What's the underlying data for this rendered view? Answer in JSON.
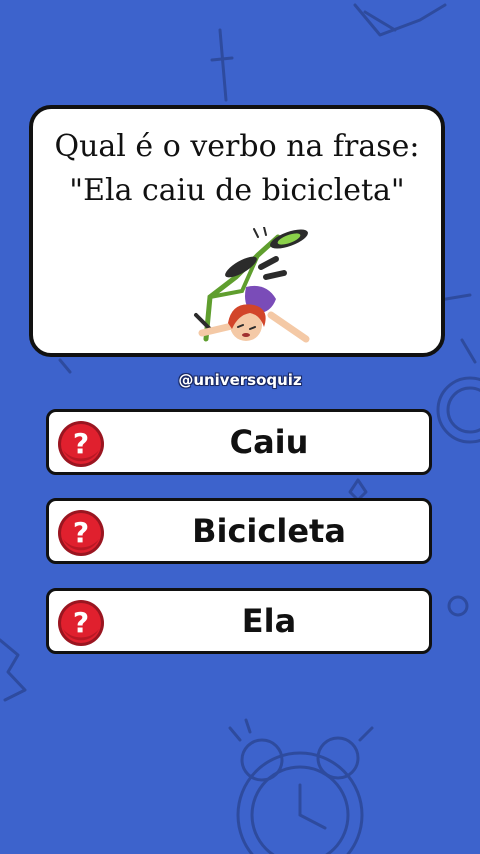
{
  "question": {
    "line1": "Qual é o verbo na frase:",
    "line2": "\"Ela caiu de bicicleta\""
  },
  "illustration": {
    "icon": "child-falling-off-bicycle-icon"
  },
  "handle": "@universoquiz",
  "options": [
    {
      "label": "Caiu",
      "icon": "question-mark-icon"
    },
    {
      "label": "Bicicleta",
      "icon": "question-mark-icon"
    },
    {
      "label": "Ela",
      "icon": "question-mark-icon"
    }
  ],
  "colors": {
    "background": "#3d63cc",
    "card": "#ffffff",
    "border": "#111111",
    "icon_red": "#e0202e"
  }
}
